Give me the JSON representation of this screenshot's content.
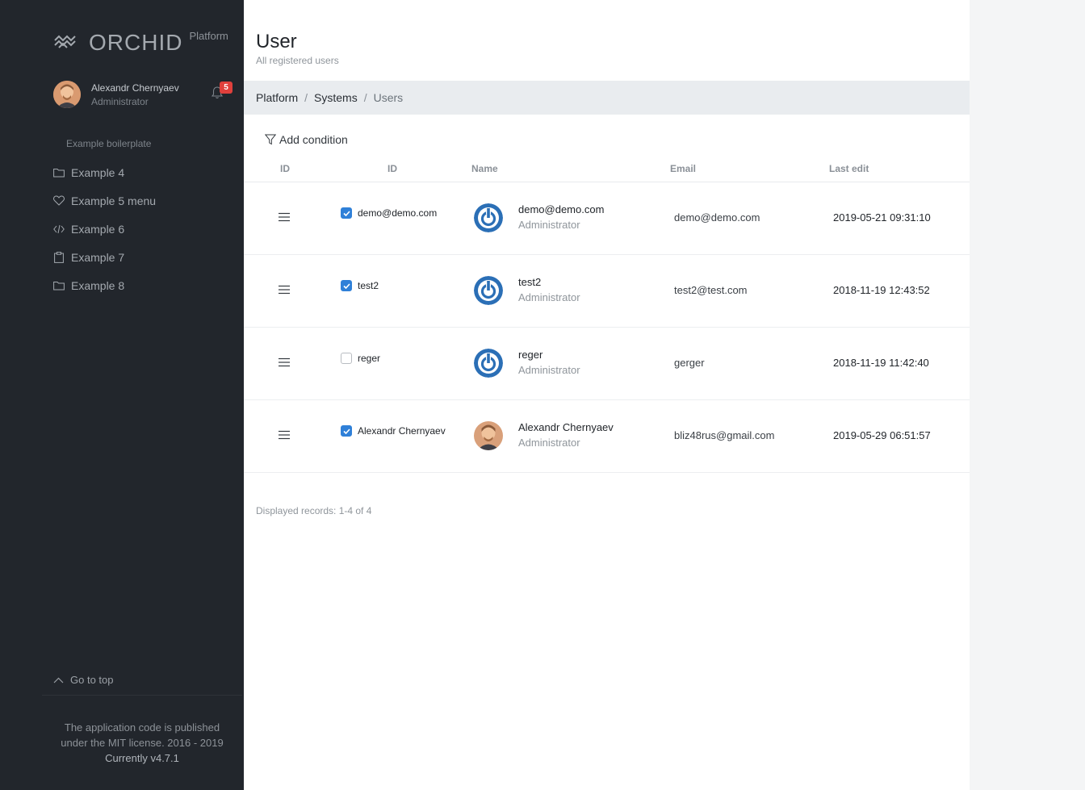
{
  "sidebar": {
    "brand": "ORCHID",
    "brand_sub": "Platform",
    "profile": {
      "name": "Alexandr Chernyaev",
      "role": "Administrator"
    },
    "notifications": "5",
    "menu_heading": "Example boilerplate",
    "menu": [
      {
        "label": "Example 4",
        "icon": "folder-icon"
      },
      {
        "label": "Example 5 menu",
        "icon": "heart-icon"
      },
      {
        "label": "Example 6",
        "icon": "code-icon"
      },
      {
        "label": "Example 7",
        "icon": "clipboard-icon"
      },
      {
        "label": "Example 8",
        "icon": "folder-icon"
      }
    ],
    "go_top": "Go to top",
    "footer_line1": "The application code is published",
    "footer_line2": "under the MIT license. 2016 - 2019",
    "footer_version": "Currently v4.7.1"
  },
  "main": {
    "title": "User",
    "subtitle": "All registered users",
    "breadcrumb": [
      "Platform",
      "Systems",
      "Users"
    ],
    "add_condition": "Add condition",
    "columns": [
      "ID",
      "ID",
      "Name",
      "Email",
      "Last edit"
    ],
    "rows": [
      {
        "checked": true,
        "id_label": "demo@demo.com",
        "name": "demo@demo.com",
        "role": "Administrator",
        "email": "demo@demo.com",
        "last_edit": "2019-05-21 09:31:10",
        "avatar": "power-icon"
      },
      {
        "checked": true,
        "id_label": "test2",
        "name": "test2",
        "role": "Administrator",
        "email": "test2@test.com",
        "last_edit": "2018-11-19 12:43:52",
        "avatar": "power-icon"
      },
      {
        "checked": false,
        "id_label": "reger",
        "name": "reger",
        "role": "Administrator",
        "email": "gerger",
        "last_edit": "2018-11-19 11:42:40",
        "avatar": "power-icon"
      },
      {
        "checked": true,
        "id_label": "Alexandr Chernyaev",
        "name": "Alexandr Chernyaev",
        "role": "Administrator",
        "email": "bliz48rus@gmail.com",
        "last_edit": "2019-05-29 06:51:57",
        "avatar": "user-photo"
      }
    ],
    "records": "Displayed records: 1-4 of 4"
  },
  "colors": {
    "sidebar_bg": "#22262c",
    "accent": "#2f80d8",
    "badge": "#e0403c",
    "breadcrumb_bg": "#e9ecef"
  }
}
